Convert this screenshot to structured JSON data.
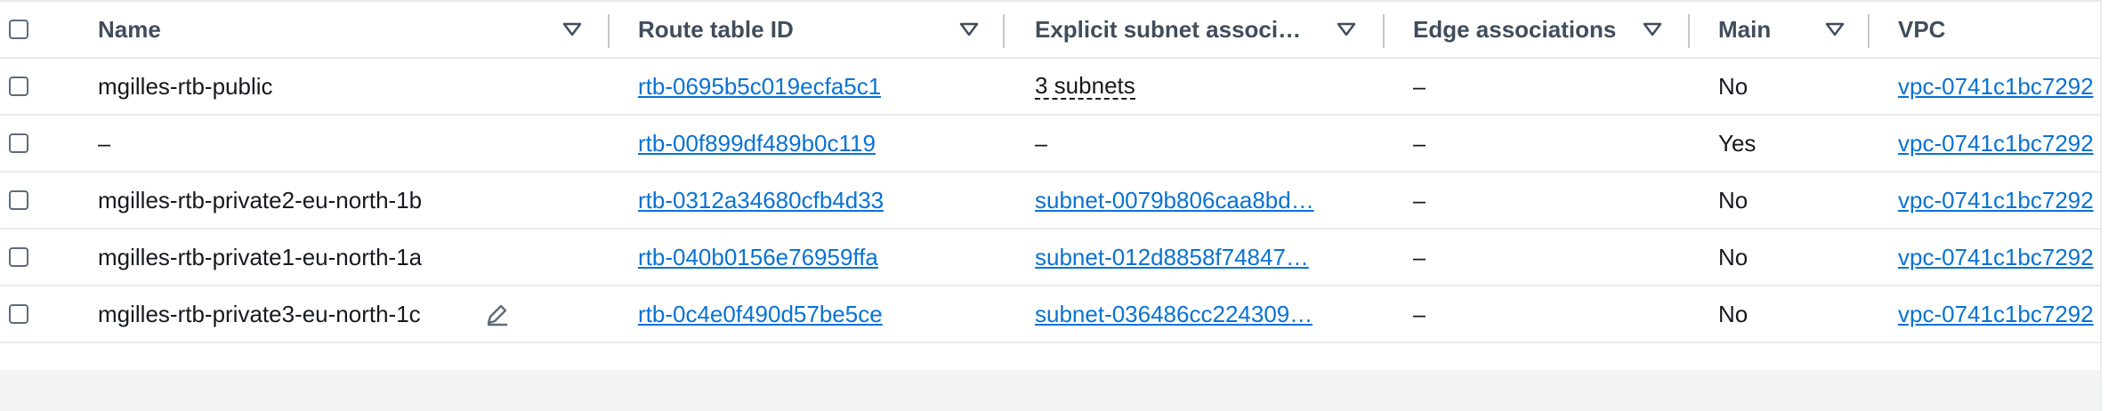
{
  "columns": [
    {
      "key": "select",
      "label": ""
    },
    {
      "key": "name",
      "label": "Name"
    },
    {
      "key": "route_table_id",
      "label": "Route table ID"
    },
    {
      "key": "explicit_subnet",
      "label": "Explicit subnet associ…"
    },
    {
      "key": "edge",
      "label": "Edge associations"
    },
    {
      "key": "main",
      "label": "Main"
    },
    {
      "key": "vpc",
      "label": "VPC"
    }
  ],
  "rows": [
    {
      "name": "mgilles-rtb-public",
      "route_table_id": "rtb-0695b5c019ecfa5c1",
      "explicit_subnet": "3 subnets",
      "edge": "–",
      "main": "No",
      "vpc": "vpc-0741c1bc7292"
    },
    {
      "name": "–",
      "route_table_id": "rtb-00f899df489b0c119",
      "explicit_subnet": "–",
      "edge": "–",
      "main": "Yes",
      "vpc": "vpc-0741c1bc7292"
    },
    {
      "name": "mgilles-rtb-private2-eu-north-1b",
      "route_table_id": "rtb-0312a34680cfb4d33",
      "explicit_subnet": "subnet-0079b806caa8bd…",
      "edge": "–",
      "main": "No",
      "vpc": "vpc-0741c1bc7292"
    },
    {
      "name": "mgilles-rtb-private1-eu-north-1a",
      "route_table_id": "rtb-040b0156e76959ffa",
      "explicit_subnet": "subnet-012d8858f74847…",
      "edge": "–",
      "main": "No",
      "vpc": "vpc-0741c1bc7292"
    },
    {
      "name": "mgilles-rtb-private3-eu-north-1c",
      "route_table_id": "rtb-0c4e0f490d57be5ce",
      "explicit_subnet": "subnet-036486cc224309…",
      "edge": "–",
      "main": "No",
      "vpc": "vpc-0741c1bc7292"
    }
  ],
  "colors": {
    "link": "#0972d3",
    "header_text": "#414d5c",
    "divider": "#c6c6cd",
    "footer_bg": "#f2f3f3"
  }
}
